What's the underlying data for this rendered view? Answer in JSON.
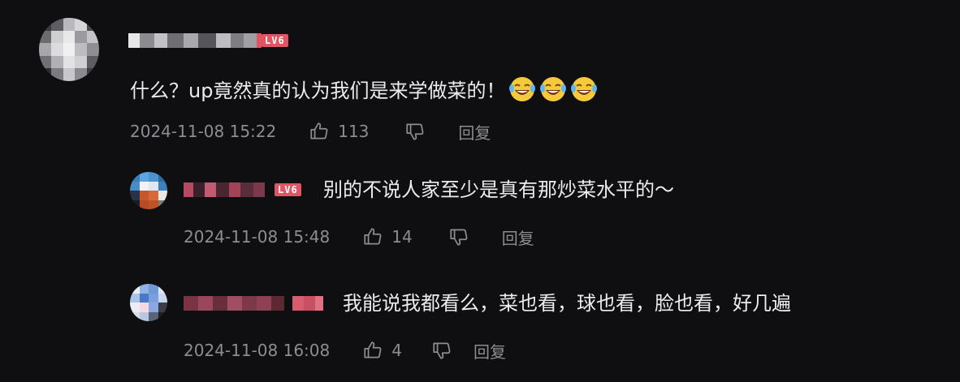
{
  "comments": [
    {
      "level": "LV6",
      "content": "什么？up竟然真的认为我们是来学做菜的！",
      "emojis": [
        "laugh-cry-emoji",
        "laugh-cry-emoji",
        "laugh-cry-emoji"
      ],
      "time": "2024-11-08 15:22",
      "likes": "113",
      "reply_label": "回复"
    },
    {
      "level": "LV6",
      "content": "别的不说人家至少是真有那炒菜水平的～",
      "time": "2024-11-08 15:48",
      "likes": "14",
      "reply_label": "回复"
    },
    {
      "level": "",
      "content": "我能说我都看么，菜也看，球也看，脸也看，好几遍",
      "time": "2024-11-08 16:08",
      "likes": "4",
      "reply_label": "回复"
    }
  ],
  "colors": {
    "background": "#0f0f12",
    "text": "#ececee",
    "meta": "#8c8c92",
    "level_badge": "#e05563"
  },
  "icons": [
    "thumbs-up-icon",
    "thumbs-down-icon"
  ]
}
